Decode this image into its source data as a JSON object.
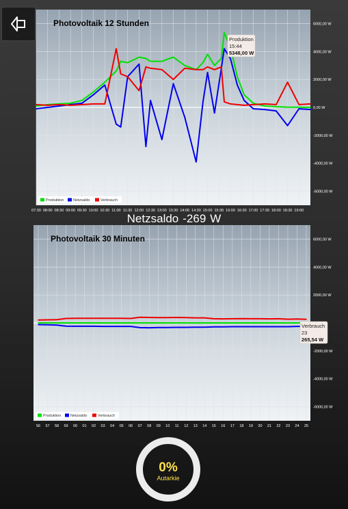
{
  "nav": {
    "back_icon": "back-arrow-icon"
  },
  "netzsaldo": {
    "label": "Netzsaldo",
    "value": "-269",
    "unit": "W"
  },
  "autarkie": {
    "value": "0%",
    "label": "Autarkie"
  },
  "chart_data": [
    {
      "type": "line",
      "title": "Photovoltaik 12 Stunden",
      "ylim": [
        -7000,
        7000
      ],
      "y_ticks": [
        6000,
        4000,
        2000,
        0,
        -2000,
        -4000,
        -6000
      ],
      "y_tick_labels": [
        "6000,00 W",
        "4000,00 W",
        "2000,00 W",
        "0,00 W",
        "-2000,00 W",
        "-4000,00 W",
        "-6000,00 W"
      ],
      "x_ticks": [
        "07:30",
        "08:00",
        "08:30",
        "09:00",
        "09:30",
        "10:00",
        "10:30",
        "11:00",
        "11:30",
        "12:00",
        "12:30",
        "13:00",
        "13:30",
        "14:00",
        "14:30",
        "15:00",
        "15:30",
        "16:00",
        "16:30",
        "17:00",
        "17:30",
        "18:00",
        "18:30",
        "19:00"
      ],
      "legend": [
        "Produktion",
        "Netzsaldo",
        "Verbrauch"
      ],
      "legend_position": "bottom-left",
      "grid": true,
      "tooltip": {
        "series": "Produktion",
        "time": "15:44",
        "value": "5348,00 W"
      },
      "x_hours": [
        7.5,
        8.0,
        8.5,
        9.0,
        9.5,
        10.0,
        10.5,
        11.0,
        11.2,
        11.5,
        12.0,
        12.3,
        12.5,
        13.0,
        13.5,
        14.0,
        14.5,
        14.8,
        15.0,
        15.3,
        15.6,
        15.73,
        16.0,
        16.3,
        16.6,
        17.0,
        17.5,
        18.0,
        18.5,
        19.0,
        19.5
      ],
      "series": [
        {
          "name": "Produktion",
          "color": "#00e000",
          "values": [
            100,
            200,
            250,
            300,
            500,
            1100,
            1800,
            2600,
            3300,
            3200,
            3600,
            3500,
            3300,
            3300,
            3600,
            3000,
            2700,
            3200,
            3800,
            3000,
            3500,
            5348,
            4300,
            2200,
            900,
            300,
            100,
            50,
            20,
            10,
            0
          ]
        },
        {
          "name": "Netzsaldo",
          "color": "#0000ee",
          "values": [
            -100,
            0,
            100,
            200,
            300,
            900,
            1600,
            -1200,
            -1400,
            2200,
            3100,
            -2800,
            500,
            -2300,
            1700,
            -700,
            -3900,
            400,
            2500,
            -400,
            2800,
            4200,
            3500,
            1600,
            500,
            -100,
            -150,
            -250,
            -1300,
            -100,
            -150
          ]
        },
        {
          "name": "Verbrauch",
          "color": "#ee0000",
          "values": [
            200,
            150,
            200,
            150,
            200,
            250,
            250,
            4200,
            2400,
            2200,
            1200,
            2900,
            2800,
            2700,
            2000,
            2800,
            2700,
            2700,
            2900,
            2700,
            2900,
            400,
            250,
            200,
            150,
            200,
            250,
            200,
            1800,
            200,
            250
          ]
        }
      ]
    },
    {
      "type": "line",
      "title": "Photovoltaik 30 Minuten",
      "ylim": [
        -7000,
        7000
      ],
      "y_ticks": [
        6000,
        4000,
        2000,
        0,
        -2000,
        -4000,
        -6000
      ],
      "y_tick_labels": [
        "6000,00 W",
        "4000,00 W",
        "2000,00 W",
        "0,00 W",
        "-2000,00 W",
        "-4000,00 W",
        "-6000,00 W"
      ],
      "x_ticks": [
        "56",
        "57",
        "58",
        "59",
        "00",
        "01",
        "02",
        "03",
        "04",
        "05",
        "06",
        "07",
        "08",
        "09",
        "10",
        "11",
        "12",
        "13",
        "14",
        "15",
        "16",
        "17",
        "18",
        "19",
        "20",
        "21",
        "22",
        "23",
        "24",
        "25"
      ],
      "legend": [
        "Produktion",
        "Netzsaldo",
        "Verbrauch"
      ],
      "legend_position": "bottom-left",
      "grid": true,
      "tooltip": {
        "series": "Verbrauch",
        "time": "23",
        "value": "265,54 W"
      },
      "series": [
        {
          "name": "Produktion",
          "color": "#00e000",
          "values": [
            0,
            0,
            0,
            0,
            0,
            0,
            0,
            0,
            0,
            0,
            0,
            0,
            0,
            0,
            0,
            0,
            0,
            0,
            0,
            0,
            0,
            0,
            0,
            0,
            0,
            0,
            0,
            0,
            0,
            0
          ]
        },
        {
          "name": "Netzsaldo",
          "color": "#0000ee",
          "values": [
            -120,
            -130,
            -150,
            -230,
            -240,
            -240,
            -240,
            -250,
            -250,
            -250,
            -250,
            -340,
            -350,
            -330,
            -330,
            -320,
            -320,
            -310,
            -310,
            -280,
            -280,
            -270,
            -270,
            -270,
            -270,
            -270,
            -270,
            -269,
            -250,
            -250
          ]
        },
        {
          "name": "Verbrauch",
          "color": "#ee0000",
          "values": [
            210,
            220,
            230,
            320,
            330,
            330,
            330,
            330,
            330,
            330,
            320,
            400,
            390,
            380,
            380,
            390,
            380,
            360,
            360,
            300,
            290,
            300,
            310,
            300,
            300,
            290,
            300,
            266,
            280,
            260
          ]
        }
      ]
    }
  ]
}
